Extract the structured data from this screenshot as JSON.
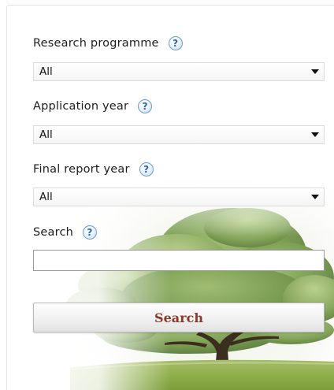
{
  "filters": {
    "research_programme": {
      "label": "Research programme",
      "value": "All",
      "help_icon": "question-mark-icon"
    },
    "application_year": {
      "label": "Application year",
      "value": "All",
      "help_icon": "question-mark-icon"
    },
    "final_report_year": {
      "label": "Final report year",
      "value": "All",
      "help_icon": "question-mark-icon"
    }
  },
  "search": {
    "label": "Search",
    "value": "",
    "help_icon": "question-mark-icon",
    "button_label": "Search"
  },
  "help_glyph": "?",
  "colors": {
    "button_text": "#8a3a2b",
    "help_icon": "#2d66b3",
    "grass": "#8fb04a",
    "foliage": "#5e8a3a"
  }
}
